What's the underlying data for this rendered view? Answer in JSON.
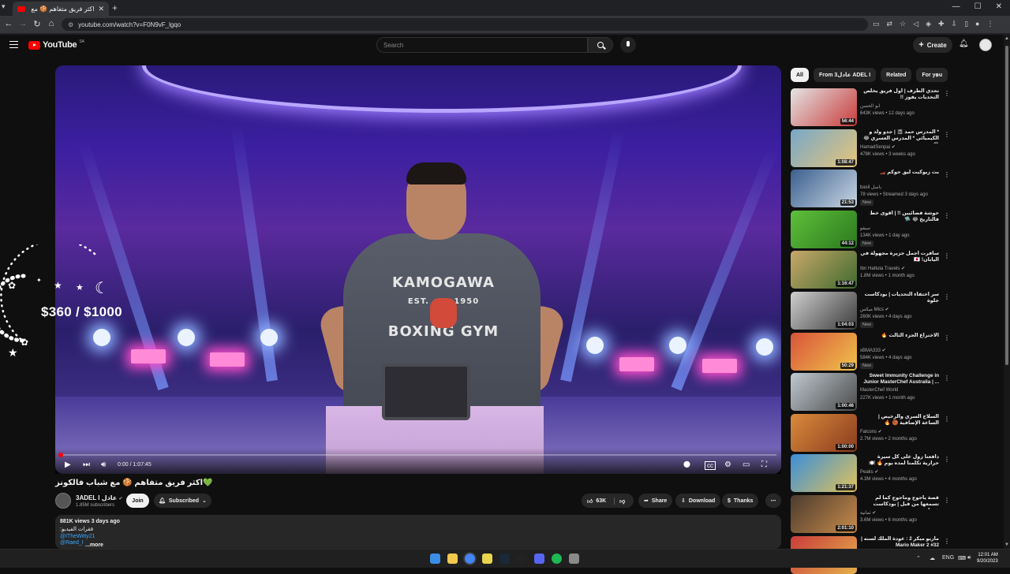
{
  "browser": {
    "tab_title": "اكثر فريق متفاهم 🍪 مع شباب فالكونز",
    "tab_close": "✕",
    "new_tab": "+",
    "url": "youtube.com/watch?v=F0N9vF_lgqo",
    "window_controls": [
      "—",
      "☐",
      "✕"
    ]
  },
  "youtube": {
    "logo_text": "YouTube",
    "country_code": "SA",
    "search_placeholder": "Search",
    "create_label": "Create",
    "create_icon": "+"
  },
  "player": {
    "overlay_goal": "$360 / $1000",
    "shirt_text_top": "KAMOGAWA",
    "shirt_text_mid": "EST.       1950",
    "shirt_text_bottom": "BOXING GYM",
    "time": "0:00 / 1:07:45",
    "progress": 0
  },
  "video": {
    "title": "💚اكثر فريق متفاهم 🍪 مع شباب فالكونز",
    "channel_name": "3ADEL I عادل",
    "channel_verified": "✔",
    "subscribers": "1.85M subscribers",
    "join_label": "Join",
    "subscribed_label": "Subscribed",
    "likes": "63K",
    "share_label": "Share",
    "download_label": "Download",
    "thanks_label": "Thanks",
    "more_actions": "⋯"
  },
  "description": {
    "stats": "881K views  3 days ago",
    "line1": "فقرات الفيديو:",
    "link1": "@ITheWitty21",
    "link2": "@Raed_I",
    "more": "...more"
  },
  "chips": [
    "All",
    "From 3عادل ADEL I",
    "Related",
    "For you"
  ],
  "recommendations": [
    {
      "title": "تحدي الظرف | اول فريق يخلص التحديات يفوز !!",
      "channel": "ابو الحسن",
      "meta": "643K views • 12 days ago",
      "duration": "56:44",
      "badge": ""
    },
    {
      "title": "* المدرس حمد 📓 | جدو ولد و الكيميائي * المدرس العسري 😂 😂",
      "channel": "HamadSenpai ✔",
      "meta": "478K views • 3 weeks ago",
      "duration": "1:08:47",
      "badge": ""
    },
    {
      "title": "بث زيوكيت ليق حوكم 🏎️",
      "channel": "basil باسل",
      "meta": "78 views • Streamed 3 days ago",
      "duration": "21:53",
      "badge": "New"
    },
    {
      "title": "حوشة فضائيين !! | اقوى خط فالتاريخ 😂 🛸",
      "channel": "سيفو",
      "meta": "134K views • 1 day ago",
      "duration": "44:12",
      "badge": "New"
    },
    {
      "title": "سافرت أجمل جزيرة مجهولة في اليابان! 🇯🇵",
      "channel": "Ibn Hattuta Travels ✔",
      "meta": "1.8M views • 1 month ago",
      "duration": "1:16:47",
      "badge": ""
    },
    {
      "title": "سر اختفاء التحديات | بودكاست جلوة",
      "channel": "ميكس Mics ✔",
      "meta": "260K views • 4 days ago",
      "duration": "1:04:03",
      "badge": "New"
    },
    {
      "title": "الاختراع الجزء الثالث 🔥",
      "channel": "xBMA333 ✔",
      "meta": "584K views • 4 days ago",
      "duration": "50:29",
      "badge": "New"
    },
    {
      "title": "Sweet Immunity Challenge in Junior MasterChef Australia | ...",
      "channel": "MasterChef World",
      "meta": "227K views • 1 month ago",
      "duration": "1:00:46",
      "badge": ""
    },
    {
      "title": "السلاح السري والرخيص | الساعة الإضافية 🏀 🔥",
      "channel": "Falcons ✔",
      "meta": "2.7M views • 2 months ago",
      "duration": "1:00:00",
      "badge": ""
    },
    {
      "title": "دافعنا زول على كل سيرة حرارية تكلمنا لمده يوم 🔥 🍽️",
      "channel": "Peaks ✔",
      "meta": "4.3M views • 4 months ago",
      "duration": "1:21:37",
      "badge": ""
    },
    {
      "title": "قصة ياجوج وماجوج كما لم تسمعها من قبل | بودكاست فنجان",
      "channel": "ثمانية ✔",
      "meta": "3.6M views • 6 months ago",
      "duration": "2:01:10",
      "badge": ""
    },
    {
      "title": "ماريو ميكر 2 : عودة الملك لسنه | Mario Maker 2 #32",
      "channel": "",
      "meta": "",
      "duration": "",
      "badge": ""
    }
  ],
  "taskbar": {
    "lang": "ENG",
    "time": "12:01 AM",
    "date": "9/20/2023",
    "tray_up": "⌃"
  },
  "colors": {
    "background": "#0f0f0f",
    "surface": "#272727",
    "accent_red": "#ff0000",
    "link_blue": "#3ea6ff"
  }
}
